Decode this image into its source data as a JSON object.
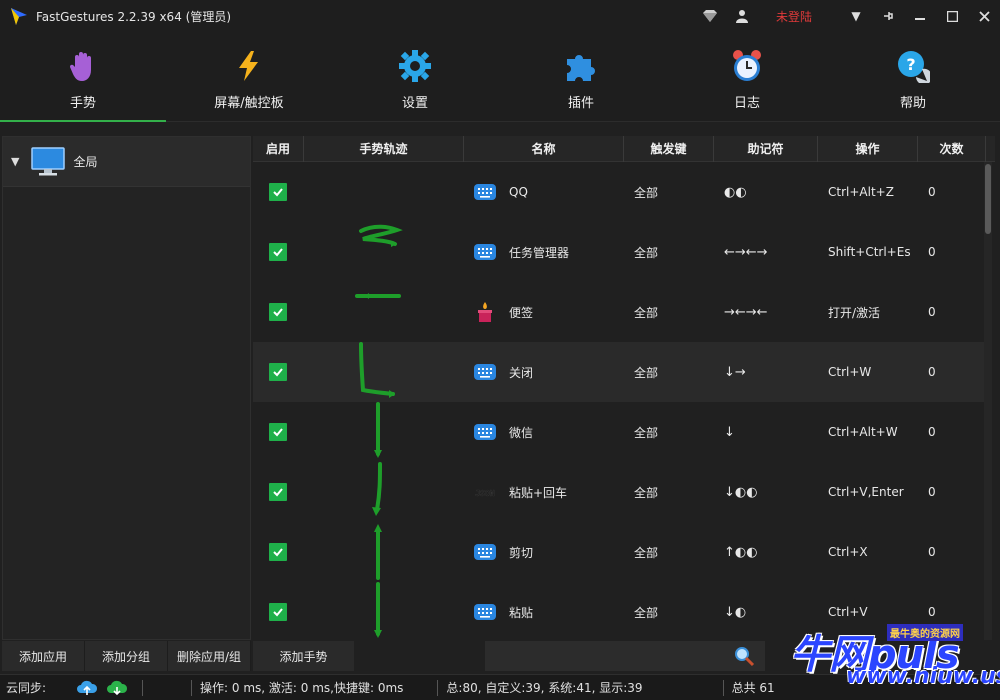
{
  "window": {
    "title": "FastGestures 2.2.39 x64  (管理员)",
    "login_status": "未登陆"
  },
  "toolbar": [
    {
      "label": "手势",
      "icon": "hand-icon",
      "active": true
    },
    {
      "label": "屏幕/触控板",
      "icon": "lightning-icon"
    },
    {
      "label": "设置",
      "icon": "gear-icon"
    },
    {
      "label": "插件",
      "icon": "puzzle-icon"
    },
    {
      "label": "日志",
      "icon": "alarm-clock-icon"
    },
    {
      "label": "帮助",
      "icon": "help-bubble-icon"
    }
  ],
  "tree": {
    "root_label": "全局"
  },
  "left_buttons": {
    "add_app": "添加应用",
    "add_group": "添加分组",
    "delete": "删除应用/组"
  },
  "table": {
    "headers": [
      "启用",
      "手势轨迹",
      "名称",
      "触发键",
      "助记符",
      "操作",
      "次数"
    ],
    "rows": [
      {
        "name": "QQ",
        "trigger": "全部",
        "mnemonic": "◐◐",
        "action": "Ctrl+Alt+Z",
        "count": "0",
        "icon": "keyboard-icon"
      },
      {
        "name": "任务管理器",
        "trigger": "全部",
        "mnemonic": "←→←→",
        "action": "Shift+Ctrl+Esc",
        "count": "0",
        "icon": "keyboard-icon"
      },
      {
        "name": "便签",
        "trigger": "全部",
        "mnemonic": "→←→←",
        "action": "打开/激活",
        "count": "0",
        "icon": "candle-icon"
      },
      {
        "name": "关闭",
        "trigger": "全部",
        "mnemonic": "↓→",
        "action": "Ctrl+W",
        "count": "0",
        "icon": "keyboard-icon"
      },
      {
        "name": "微信",
        "trigger": "全部",
        "mnemonic": "↓",
        "action": "Ctrl+Alt+W",
        "count": "0",
        "icon": "keyboard-icon"
      },
      {
        "name": "粘贴+回车",
        "trigger": "全部",
        "mnemonic": "↓◐◐",
        "action": "Ctrl+V,Enter",
        "count": "0",
        "icon": "json-icon"
      },
      {
        "name": "剪切",
        "trigger": "全部",
        "mnemonic": "↑◐◐",
        "action": "Ctrl+X",
        "count": "0",
        "icon": "keyboard-icon"
      },
      {
        "name": "粘贴",
        "trigger": "全部",
        "mnemonic": "↓◐",
        "action": "Ctrl+V",
        "count": "0",
        "icon": "keyboard-icon"
      }
    ]
  },
  "add_gesture": "添加手势",
  "status": {
    "cloud_sync": "云同步:",
    "timing": "操作: 0 ms, 激活: 0 ms,快捷键: 0ms",
    "totals": "总:80, 自定义:39, 系统:41, 显示:39",
    "total_prefix": "总共 61"
  },
  "watermark": {
    "main": "牛网puls",
    "tag": "最牛奥的资源网",
    "url": "www.niuw.us"
  },
  "colors": {
    "accent": "#33b04a",
    "check": "#1fb04a",
    "login": "#e03a3a",
    "gesture_trace": "#1e9e2a"
  }
}
